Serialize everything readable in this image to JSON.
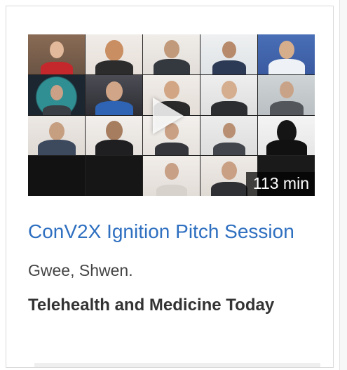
{
  "result": {
    "title": "ConV2X Ignition Pitch Session",
    "author": "Gwee, Shwen.",
    "source": "Telehealth and Medicine Today",
    "duration": "113 min"
  },
  "icons": {
    "play": "play-icon"
  },
  "colors": {
    "title_link": "#2e6fc0",
    "author_text": "#444444",
    "source_text": "#333333",
    "card_border": "#d9d9d9"
  }
}
